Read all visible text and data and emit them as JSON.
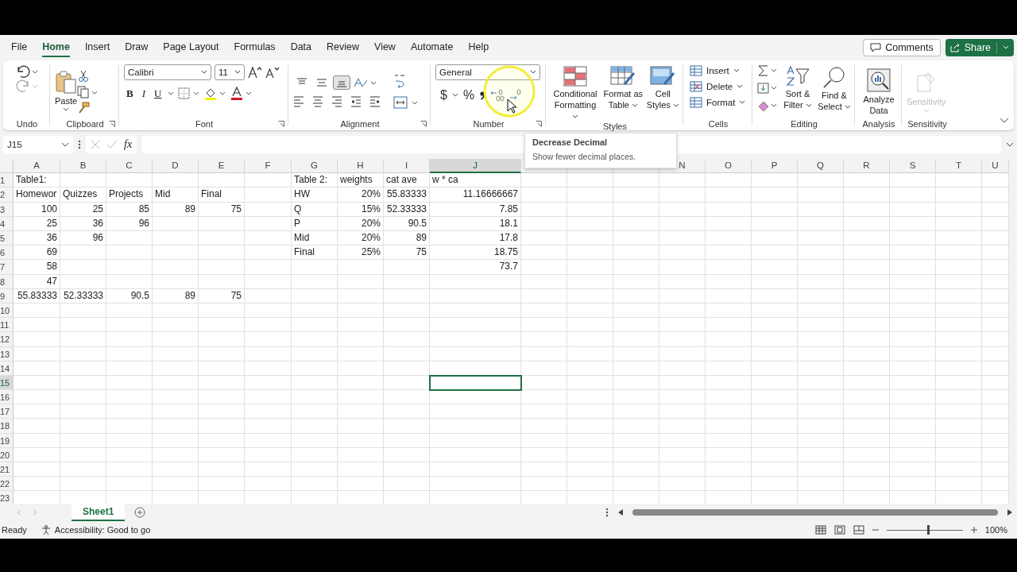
{
  "menu_tabs": [
    {
      "label": "File",
      "selected": false
    },
    {
      "label": "Home",
      "selected": true
    },
    {
      "label": "Insert",
      "selected": false
    },
    {
      "label": "Draw",
      "selected": false
    },
    {
      "label": "Page Layout",
      "selected": false
    },
    {
      "label": "Formulas",
      "selected": false
    },
    {
      "label": "Data",
      "selected": false
    },
    {
      "label": "Review",
      "selected": false
    },
    {
      "label": "View",
      "selected": false
    },
    {
      "label": "Automate",
      "selected": false
    },
    {
      "label": "Help",
      "selected": false
    }
  ],
  "comments_button": "Comments",
  "share_button": "Share",
  "ribbon": {
    "undo": {
      "label": "Undo"
    },
    "clipboard": {
      "label": "Clipboard",
      "paste": "Paste"
    },
    "font": {
      "label": "Font",
      "name": "Calibri",
      "size": "11",
      "styles": [
        "B",
        "I",
        "U"
      ]
    },
    "alignment": {
      "label": "Alignment",
      "vertical_buttons": [
        {
          "selected": false
        },
        {
          "selected": false
        },
        {
          "selected": true
        }
      ]
    },
    "number": {
      "label": "Number",
      "format": "General",
      "symbols": [
        "$",
        "%"
      ]
    },
    "styles": {
      "label": "Styles",
      "buttons": [
        "Conditional Formatting",
        "Format as Table",
        "Cell Styles"
      ]
    },
    "cells": {
      "label": "Cells",
      "buttons": [
        "Insert",
        "Delete",
        "Format"
      ]
    },
    "editing": {
      "label": "Editing",
      "buttons": [
        "Sort & Filter",
        "Find & Select"
      ]
    },
    "analysis": {
      "label": "Analysis",
      "button": "Analyze Data"
    },
    "sensitivity": {
      "label": "Sensitivity",
      "button": "Sensitivity",
      "disabled": true
    }
  },
  "tooltip": {
    "title": "Decrease Decimal",
    "text": "Show fewer decimal places."
  },
  "formula_bar": {
    "name_box": "J15",
    "function_label": "fx"
  },
  "sheet": {
    "columns": [
      {
        "label": "A",
        "selected": false
      },
      {
        "label": "B",
        "selected": false
      },
      {
        "label": "C",
        "selected": false
      },
      {
        "label": "D",
        "selected": false
      },
      {
        "label": "E",
        "selected": false
      },
      {
        "label": "F",
        "selected": false
      },
      {
        "label": "G",
        "selected": false
      },
      {
        "label": "H",
        "selected": false
      },
      {
        "label": "I",
        "selected": false
      },
      {
        "label": "J",
        "selected": true
      }
    ],
    "columns_right": [
      "N",
      "O",
      "P",
      "Q",
      "R",
      "S",
      "T",
      "U"
    ],
    "rows": [
      {
        "number": "1",
        "selected": false,
        "cells": [
          {
            "text": "Table1:",
            "kind": "text"
          },
          null,
          null,
          null,
          null,
          null,
          {
            "text": "Table 2:",
            "kind": "text"
          },
          {
            "text": "weights",
            "kind": "text"
          },
          {
            "text": "cat ave",
            "kind": "text"
          },
          {
            "text": "w * ca",
            "kind": "text"
          }
        ]
      },
      {
        "number": "2",
        "selected": false,
        "cells": [
          {
            "text": "Homewor",
            "kind": "text"
          },
          {
            "text": "Quizzes",
            "kind": "text"
          },
          {
            "text": "Projects",
            "kind": "text"
          },
          {
            "text": "Mid",
            "kind": "text"
          },
          {
            "text": "Final",
            "kind": "text"
          },
          null,
          {
            "text": "HW",
            "kind": "text"
          },
          {
            "text": "20%",
            "kind": "number"
          },
          {
            "text": "55.83333",
            "kind": "number"
          },
          {
            "text": "11.16666667",
            "kind": "number"
          }
        ]
      },
      {
        "number": "3",
        "selected": false,
        "cells": [
          {
            "text": "100",
            "kind": "number"
          },
          {
            "text": "25",
            "kind": "number"
          },
          {
            "text": "85",
            "kind": "number"
          },
          {
            "text": "89",
            "kind": "number"
          },
          {
            "text": "75",
            "kind": "number"
          },
          null,
          {
            "text": "Q",
            "kind": "text"
          },
          {
            "text": "15%",
            "kind": "number"
          },
          {
            "text": "52.33333",
            "kind": "number"
          },
          {
            "text": "7.85",
            "kind": "number"
          }
        ]
      },
      {
        "number": "4",
        "selected": false,
        "cells": [
          {
            "text": "25",
            "kind": "number"
          },
          {
            "text": "36",
            "kind": "number"
          },
          {
            "text": "96",
            "kind": "number"
          },
          null,
          null,
          null,
          {
            "text": "P",
            "kind": "text"
          },
          {
            "text": "20%",
            "kind": "number"
          },
          {
            "text": "90.5",
            "kind": "number"
          },
          {
            "text": "18.1",
            "kind": "number"
          }
        ]
      },
      {
        "number": "5",
        "selected": false,
        "cells": [
          {
            "text": "36",
            "kind": "number"
          },
          {
            "text": "96",
            "kind": "number"
          },
          null,
          null,
          null,
          null,
          {
            "text": "Mid",
            "kind": "text"
          },
          {
            "text": "20%",
            "kind": "number"
          },
          {
            "text": "89",
            "kind": "number"
          },
          {
            "text": "17.8",
            "kind": "number"
          }
        ]
      },
      {
        "number": "6",
        "selected": false,
        "cells": [
          {
            "text": "69",
            "kind": "number"
          },
          null,
          null,
          null,
          null,
          null,
          {
            "text": "Final",
            "kind": "text"
          },
          {
            "text": "25%",
            "kind": "number"
          },
          {
            "text": "75",
            "kind": "number"
          },
          {
            "text": "18.75",
            "kind": "number"
          }
        ]
      },
      {
        "number": "7",
        "selected": false,
        "cells": [
          {
            "text": "58",
            "kind": "number"
          },
          null,
          null,
          null,
          null,
          null,
          null,
          null,
          null,
          {
            "text": "73.7",
            "kind": "number"
          }
        ]
      },
      {
        "number": "8",
        "selected": false,
        "cells": [
          {
            "text": "47",
            "kind": "number"
          }
        ]
      },
      {
        "number": "9",
        "selected": false,
        "cells": [
          {
            "text": "55.83333",
            "kind": "number"
          },
          {
            "text": "52.33333",
            "kind": "number"
          },
          {
            "text": "90.5",
            "kind": "number"
          },
          {
            "text": "89",
            "kind": "number"
          },
          {
            "text": "75",
            "kind": "number"
          }
        ]
      },
      {
        "number": "10",
        "selected": false
      },
      {
        "number": "11",
        "selected": false
      },
      {
        "number": "12",
        "selected": false
      },
      {
        "number": "13",
        "selected": false
      },
      {
        "number": "14",
        "selected": false
      },
      {
        "number": "15",
        "selected": true
      },
      {
        "number": "16",
        "selected": false
      },
      {
        "number": "17",
        "selected": false
      },
      {
        "number": "18",
        "selected": false
      },
      {
        "number": "19",
        "selected": false
      },
      {
        "number": "20",
        "selected": false
      },
      {
        "number": "21",
        "selected": false
      },
      {
        "number": "22",
        "selected": false
      },
      {
        "number": "23",
        "selected": false
      }
    ]
  },
  "sheet_tabs": [
    {
      "label": "Sheet1",
      "selected": true
    }
  ],
  "status_bar": {
    "mode": "Ready",
    "accessibility": "Accessibility: Good to go",
    "zoom": "100%",
    "zoom_slider": {
      "level": 0.53
    }
  }
}
